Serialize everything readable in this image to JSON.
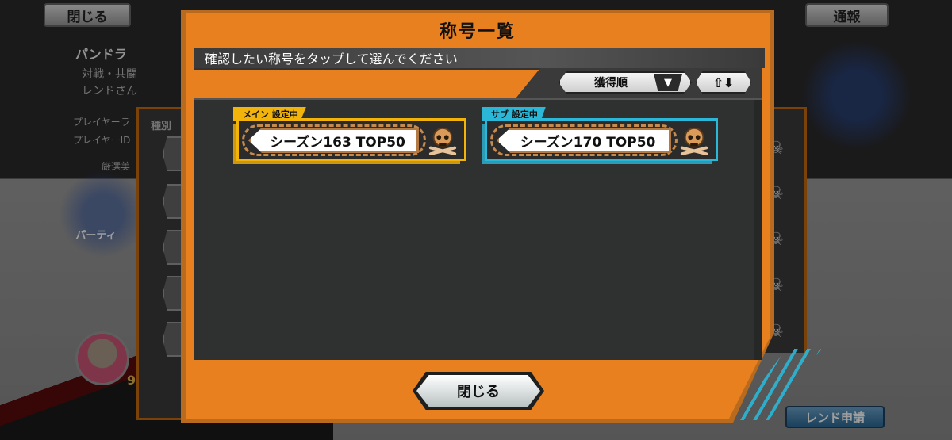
{
  "background": {
    "close_label": "閉じる",
    "report_label": "通報",
    "player_name": "パンドラ",
    "player_desc_1": "対戦・共闘",
    "player_desc_2": "レンドさん",
    "player_rank_label": "プレイヤーラ",
    "player_id_label": "プレイヤーID",
    "selected_label": "厳選美",
    "category_label": "種別",
    "party_label": "パーティ",
    "friend_request_label": "レンド申請",
    "level_badge": "9"
  },
  "dialog": {
    "title": "称号一覧",
    "instruction": "確認したい称号をタップして選んでください",
    "sort": {
      "selected": "獲得順",
      "caret": "▼",
      "order_icon": "⇧⬇"
    },
    "cards": [
      {
        "tag": "メイン 設定中",
        "title": "シーズン163 TOP50",
        "color": "#f2b40a",
        "icon": "skull-crossbones-icon"
      },
      {
        "tag": "サブ 設定中",
        "title": "シーズン170 TOP50",
        "color": "#2ab7d8",
        "icon": "skull-crossbones-icon"
      }
    ],
    "close_label": "閉じる"
  },
  "colors": {
    "dialog_orange": "#e9801f",
    "content_dark": "#2f3131",
    "main_accent": "#f2b40a",
    "sub_accent": "#2ab7d8"
  }
}
